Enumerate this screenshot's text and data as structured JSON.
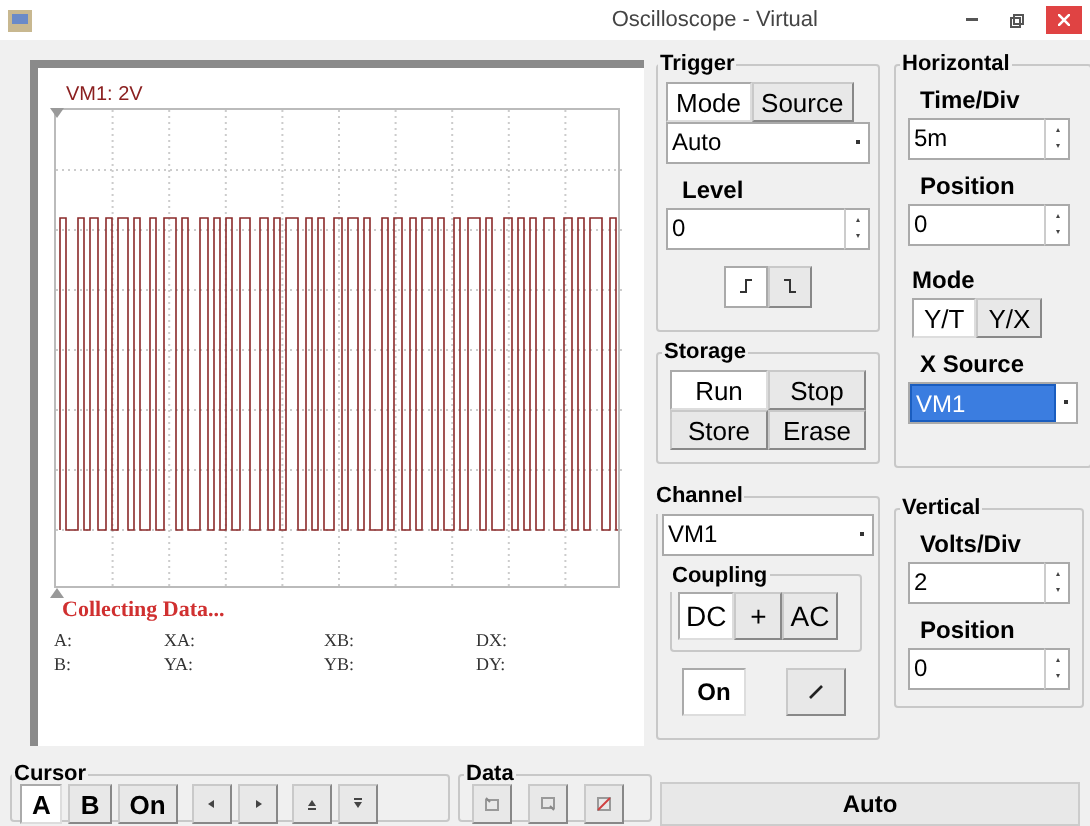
{
  "window": {
    "title": "Oscilloscope - Virtual"
  },
  "screen": {
    "channel_label": "VM1: 2V",
    "status": "Collecting Data...",
    "readouts": [
      "A:",
      "XA:",
      "XB:",
      "DX:",
      "B:",
      "YA:",
      "YB:",
      "DY:"
    ]
  },
  "cursor": {
    "title": "Cursor",
    "buttons": [
      {
        "label": "A",
        "selected": true
      },
      {
        "label": "B",
        "selected": false
      },
      {
        "label": "On",
        "selected": false
      }
    ]
  },
  "data": {
    "title": "Data"
  },
  "trigger": {
    "title": "Trigger",
    "tabs": [
      {
        "label": "Mode",
        "selected": true
      },
      {
        "label": "Source",
        "selected": false
      }
    ],
    "mode_value": "Auto",
    "level_label": "Level",
    "level_value": "0",
    "edges": [
      {
        "kind": "rising",
        "selected": true
      },
      {
        "kind": "falling",
        "selected": false
      }
    ]
  },
  "horizontal": {
    "title": "Horizontal",
    "time_div_label": "Time/Div",
    "time_div_value": "5m",
    "position_label": "Position",
    "position_value": "0",
    "mode_label": "Mode",
    "modes": [
      {
        "label": "Y/T",
        "selected": true
      },
      {
        "label": "Y/X",
        "selected": false
      }
    ],
    "x_source_label": "X Source",
    "x_source_value": "VM1"
  },
  "storage": {
    "title": "Storage",
    "buttons": [
      {
        "label": "Run",
        "selected": true
      },
      {
        "label": "Stop",
        "selected": false
      },
      {
        "label": "Store",
        "selected": false
      },
      {
        "label": "Erase",
        "selected": false
      }
    ]
  },
  "channel": {
    "title": "Channel",
    "value": "VM1",
    "coupling_title": "Coupling",
    "coupling": [
      {
        "label": "DC",
        "selected": true
      },
      {
        "label": "+",
        "selected": false
      },
      {
        "label": "AC",
        "selected": false
      }
    ],
    "on_button": {
      "label": "On",
      "selected": true
    }
  },
  "vertical": {
    "title": "Vertical",
    "volts_label": "Volts/Div",
    "volts_value": "2",
    "position_label": "Position",
    "position_value": "0"
  },
  "auto_button": "Auto"
}
